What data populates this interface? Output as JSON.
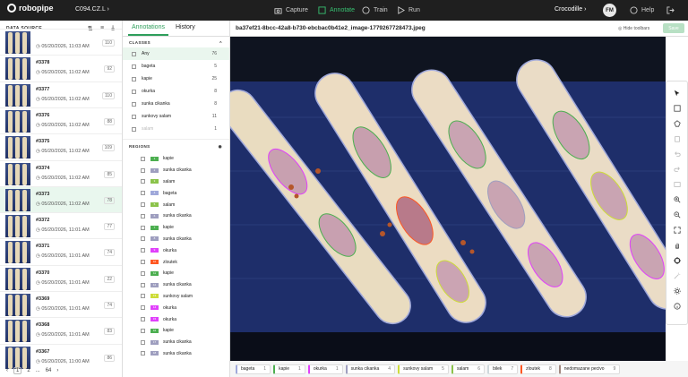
{
  "app": {
    "logo": "robopipe",
    "project": "C094.CZ.L",
    "workspace": "Crocodille",
    "avatar": "FM"
  },
  "nav": [
    {
      "label": "Capture",
      "icon": "camera-icon",
      "active": false
    },
    {
      "label": "Annotate",
      "icon": "annotate-icon",
      "active": true
    },
    {
      "label": "Train",
      "icon": "train-icon",
      "active": false
    },
    {
      "label": "Run",
      "icon": "run-icon",
      "active": false
    }
  ],
  "help": "Help",
  "data_source": {
    "title": "DATA SOURCE",
    "items": [
      {
        "id": "",
        "date": "05/20/2026, 11:03 AM",
        "count": "110"
      },
      {
        "id": "#3378",
        "date": "05/20/2026, 11:02 AM",
        "count": "92"
      },
      {
        "id": "#3377",
        "date": "05/20/2026, 11:02 AM",
        "count": "110"
      },
      {
        "id": "#3376",
        "date": "05/20/2026, 11:02 AM",
        "count": "88"
      },
      {
        "id": "#3375",
        "date": "05/20/2026, 11:02 AM",
        "count": "109"
      },
      {
        "id": "#3374",
        "date": "05/20/2026, 11:02 AM",
        "count": "85"
      },
      {
        "id": "#3373",
        "date": "05/20/2026, 11:02 AM",
        "count": "78"
      },
      {
        "id": "#3372",
        "date": "05/20/2026, 11:01 AM",
        "count": "77"
      },
      {
        "id": "#3371",
        "date": "05/20/2026, 11:01 AM",
        "count": "74"
      },
      {
        "id": "#3370",
        "date": "05/20/2026, 11:01 AM",
        "count": "22"
      },
      {
        "id": "#3369",
        "date": "05/20/2026, 11:01 AM",
        "count": "74"
      },
      {
        "id": "#3368",
        "date": "05/20/2026, 11:01 AM",
        "count": "83"
      },
      {
        "id": "#3367",
        "date": "05/20/2026, 11:00 AM",
        "count": "86"
      }
    ],
    "selected": 6,
    "pager": {
      "pages": [
        "1",
        "2",
        "...",
        "64"
      ],
      "current": "1"
    }
  },
  "tabs": {
    "annotations": "Annotations",
    "history": "History"
  },
  "classes": {
    "title": "CLASSES",
    "items": [
      {
        "name": "Any",
        "count": "76"
      },
      {
        "name": "bageta",
        "count": "5"
      },
      {
        "name": "kapie",
        "count": "25"
      },
      {
        "name": "okurka",
        "count": "8"
      },
      {
        "name": "sunka cikanka",
        "count": "8"
      },
      {
        "name": "sunkovy salam",
        "count": "11"
      },
      {
        "name": "salam",
        "count": "1"
      }
    ]
  },
  "regions": {
    "title": "REGIONS",
    "items": [
      {
        "num": "1",
        "name": "kapie",
        "color": "#4caf50"
      },
      {
        "num": "2",
        "name": "sunka cikanka",
        "color": "#9e9ebf"
      },
      {
        "num": "3",
        "name": "salam",
        "color": "#8bc34a"
      },
      {
        "num": "4",
        "name": "bageta",
        "color": "#9fa8da"
      },
      {
        "num": "5",
        "name": "salam",
        "color": "#8bc34a"
      },
      {
        "num": "6",
        "name": "sunka cikanka",
        "color": "#9e9ebf"
      },
      {
        "num": "7",
        "name": "kapie",
        "color": "#4caf50"
      },
      {
        "num": "8",
        "name": "sunka cikanka",
        "color": "#9e9ebf"
      },
      {
        "num": "9",
        "name": "okurka",
        "color": "#e040fb"
      },
      {
        "num": "10",
        "name": "zloutek",
        "color": "#ff5722"
      },
      {
        "num": "11",
        "name": "kapie",
        "color": "#4caf50"
      },
      {
        "num": "12",
        "name": "sunka cikanka",
        "color": "#9e9ebf"
      },
      {
        "num": "13",
        "name": "sunkovy salam",
        "color": "#cddc39"
      },
      {
        "num": "14",
        "name": "okurka",
        "color": "#e040fb"
      },
      {
        "num": "15",
        "name": "okurka",
        "color": "#e040fb"
      },
      {
        "num": "16",
        "name": "kapie",
        "color": "#4caf50"
      },
      {
        "num": "17",
        "name": "sunka cikanka",
        "color": "#9e9ebf"
      },
      {
        "num": "18",
        "name": "sunka cikanka",
        "color": "#9e9ebf"
      }
    ]
  },
  "file": {
    "name": "ba37ef21-8bcc-42a8-b730-ebcbac0b41e2_image-1779267728473.jpeg",
    "hide_toolbars": "Hide toolbars",
    "save": "Save"
  },
  "chips": [
    {
      "name": "bageta",
      "count": "1",
      "color": "#9fa8da"
    },
    {
      "name": "kapie",
      "count": "1",
      "color": "#4caf50"
    },
    {
      "name": "okurka",
      "count": "1",
      "color": "#e040fb"
    },
    {
      "name": "sunka cikanka",
      "count": "4",
      "color": "#9e9ebf"
    },
    {
      "name": "sunkovy salam",
      "count": "5",
      "color": "#cddc39"
    },
    {
      "name": "salam",
      "count": "6",
      "color": "#8bc34a"
    },
    {
      "name": "bilek",
      "count": "7",
      "color": "#cfd8dc"
    },
    {
      "name": "zloutek",
      "count": "8",
      "color": "#ff5722"
    },
    {
      "name": "nedomazane pecivo",
      "count": "9",
      "color": "#a1887f"
    }
  ]
}
